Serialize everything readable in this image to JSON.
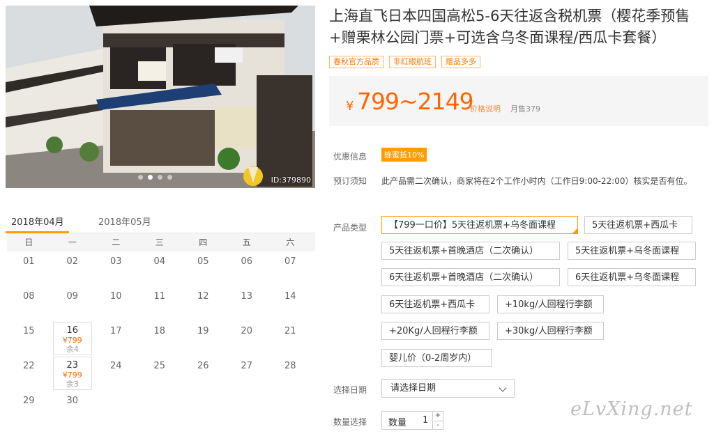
{
  "photo": {
    "id_label": "ID:379890"
  },
  "calendar": {
    "tabs": [
      "2018年04月",
      "2018年05月"
    ],
    "weekdays": [
      "日",
      "一",
      "二",
      "三",
      "四",
      "五",
      "六"
    ],
    "days": [
      {
        "d": "01"
      },
      {
        "d": "02"
      },
      {
        "d": "03"
      },
      {
        "d": "04"
      },
      {
        "d": "05"
      },
      {
        "d": "06"
      },
      {
        "d": "07"
      },
      {
        "d": "08"
      },
      {
        "d": "09"
      },
      {
        "d": "10"
      },
      {
        "d": "11"
      },
      {
        "d": "12"
      },
      {
        "d": "13"
      },
      {
        "d": "14"
      },
      {
        "d": "15"
      },
      {
        "d": "16",
        "price": "¥799",
        "remain": "余4"
      },
      {
        "d": "17"
      },
      {
        "d": "18"
      },
      {
        "d": "19"
      },
      {
        "d": "20"
      },
      {
        "d": "21"
      },
      {
        "d": "22"
      },
      {
        "d": "23",
        "price": "¥799",
        "remain": "余3"
      },
      {
        "d": "24"
      },
      {
        "d": "25"
      },
      {
        "d": "26"
      },
      {
        "d": "27"
      },
      {
        "d": "28"
      },
      {
        "d": "29"
      },
      {
        "d": "30"
      }
    ]
  },
  "product": {
    "title": "上海直飞日本四国高松5-6天往返含税机票（樱花季预售+赠栗林公园门票+可选含乌冬面课程/西瓜卡套餐）",
    "badges": [
      "春秋官方品质",
      "非红眼航班",
      "赠品多多"
    ],
    "price_currency": "¥",
    "price_range": "799~2149",
    "price_link": "价格说明",
    "sold": "月售379"
  },
  "info": {
    "promo_label": "优惠信息",
    "promo_badge": "蜂蜜抵10%",
    "notice_label": "预订须知",
    "notice_text": "此产品需二次确认，商家将在2个工作小时内（工作日9:00-22:00）核实是否有位。",
    "type_label": "产品类型",
    "options": [
      "【799一口价】5天往返机票+乌冬面课程",
      "5天往返机票+西瓜卡",
      "5天往返机票+首晚酒店（二次确认）",
      "5天往返机票+乌冬面课程",
      "6天往返机票+首晚酒店（二次确认）",
      "6天往返机票+乌冬面课程",
      "6天往返机票+西瓜卡",
      "+10kg/人回程行李额",
      "+20Kg/人回程行李额",
      "+30kg/人回程行李额",
      "婴儿价（0-2周岁内）"
    ],
    "date_label": "选择日期",
    "date_placeholder": "请选择日期",
    "qty_label": "数量选择",
    "qty_word": "数量",
    "qty_value": "1",
    "plus": "+",
    "minus": "-"
  },
  "watermark": "eLvXing.net"
}
